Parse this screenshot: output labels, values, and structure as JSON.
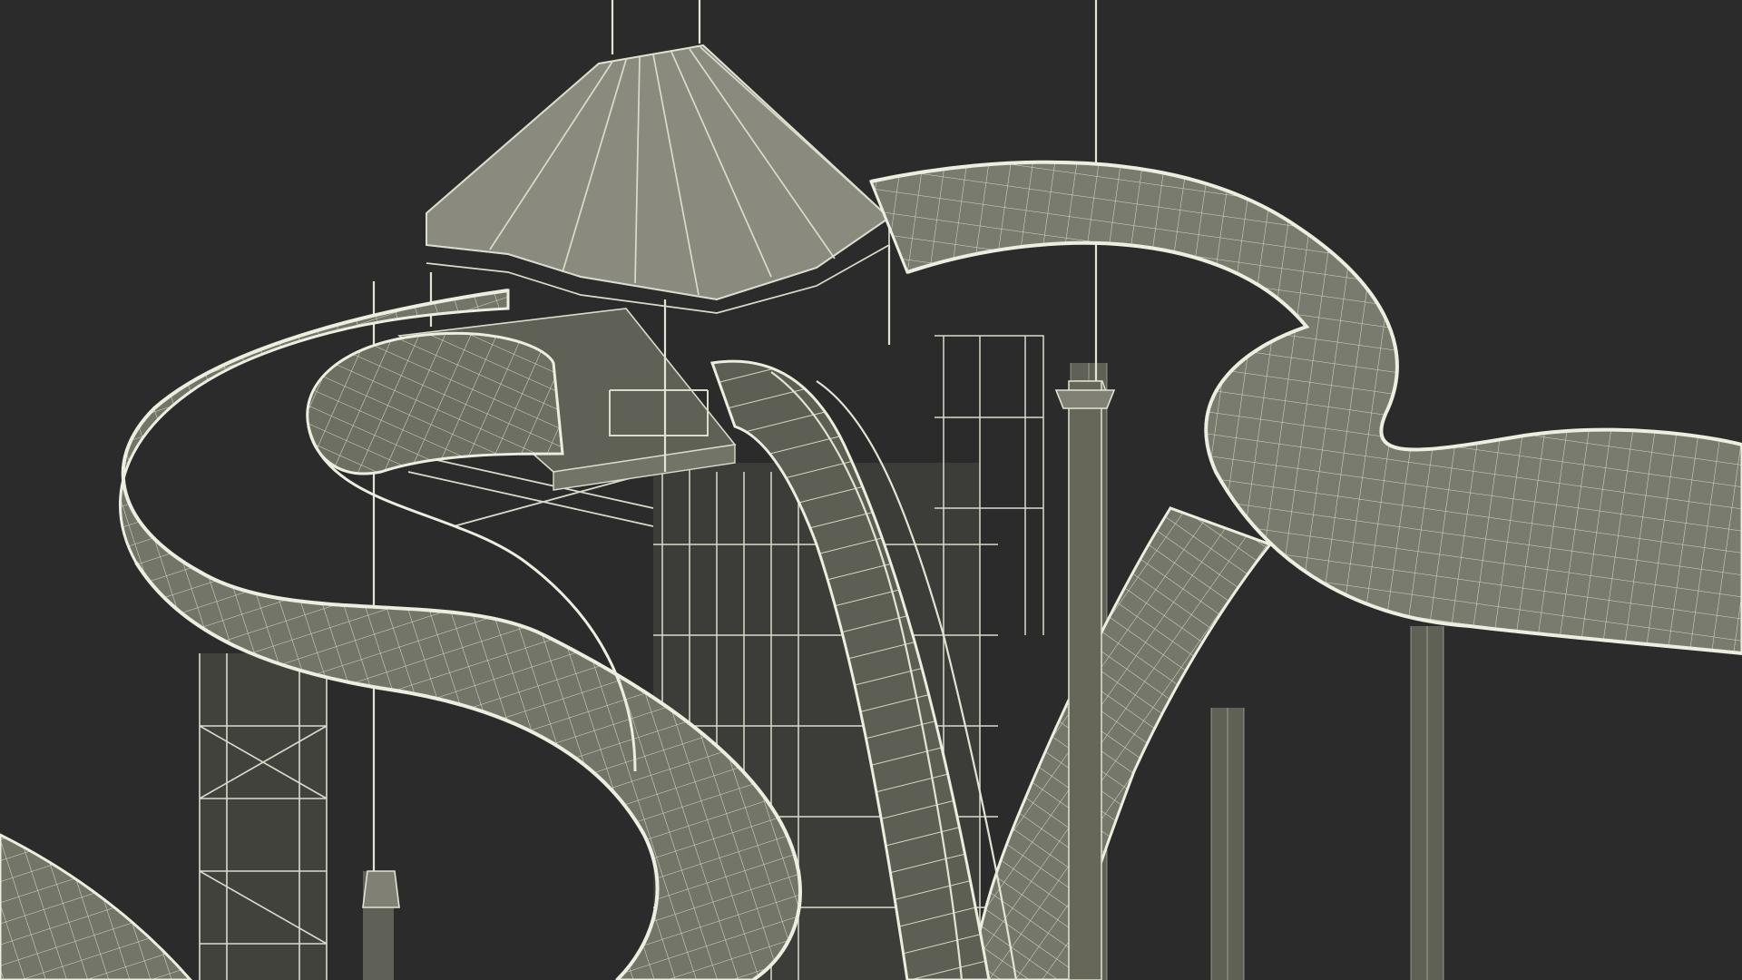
{
  "scene": {
    "subject": "water-slide-tower-wireframe",
    "background_color": "#2b2b2b",
    "wire_color": "#d9dccb",
    "surface_color": "#737468"
  }
}
